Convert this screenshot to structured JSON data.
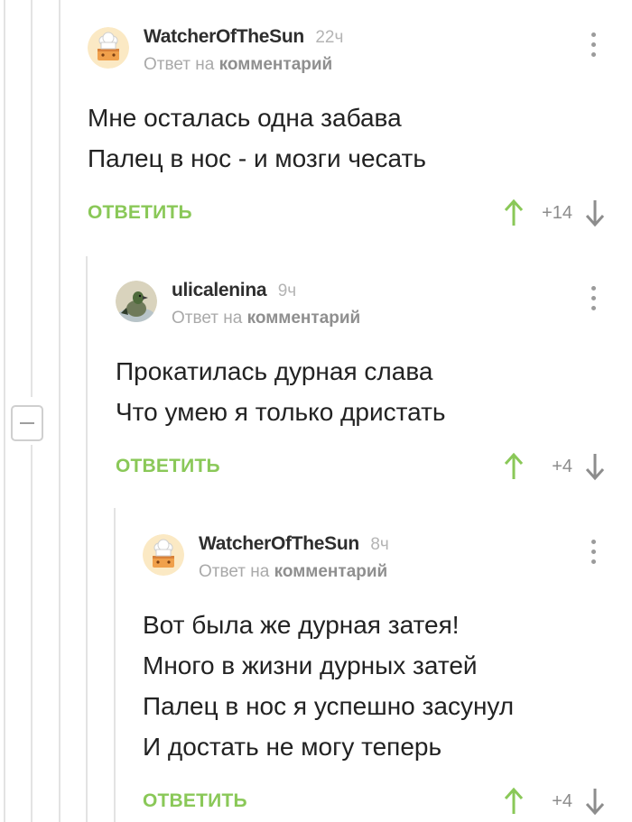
{
  "thread": {
    "comments": [
      {
        "username": "WatcherOfTheSun",
        "time": "22ч",
        "reply_prefix": "Ответ на",
        "reply_link": "комментарий",
        "lines": [
          "Мне осталась одна забава",
          "Палец в нос - и мозги чесать"
        ],
        "reply_label": "ОТВЕТИТЬ",
        "score": "+14",
        "avatar_icon": "chef-cake-avatar"
      },
      {
        "username": "ulicalenina",
        "time": "9ч",
        "reply_prefix": "Ответ на",
        "reply_link": "комментарий",
        "lines": [
          "Прокатилась дурная слава",
          "Что умею я только дристать"
        ],
        "reply_label": "ОТВЕТИТЬ",
        "score": "+4",
        "avatar_icon": "pigeon-avatar"
      },
      {
        "username": "WatcherOfTheSun",
        "time": "8ч",
        "reply_prefix": "Ответ на",
        "reply_link": "комментарий",
        "lines": [
          "Вот была же дурная затея!",
          "Много в жизни дурных затей",
          "Палец в нос я успешно засунул",
          "И достать не могу теперь"
        ],
        "reply_label": "ОТВЕТИТЬ",
        "score": "+4",
        "avatar_icon": "chef-cake-avatar"
      }
    ]
  },
  "colors": {
    "accent_green": "#8ac858",
    "muted_text": "#a9a9a9",
    "rail": "#e3e3e3"
  }
}
